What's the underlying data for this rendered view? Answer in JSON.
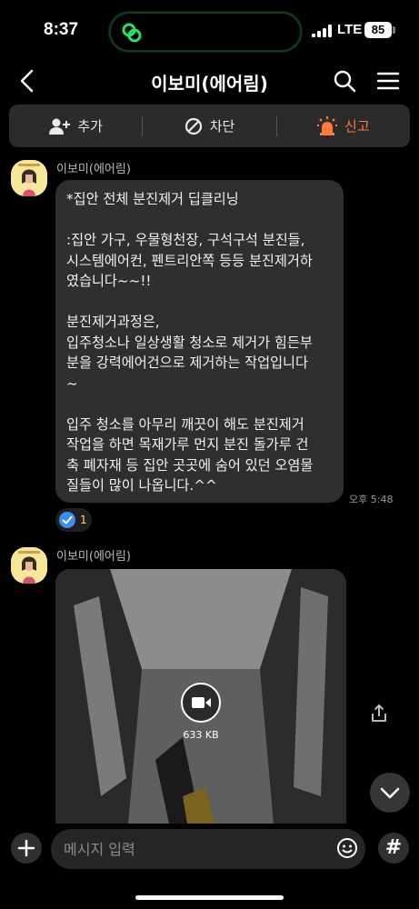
{
  "status_bar": {
    "time": "8:37",
    "network": "LTE",
    "battery": "85",
    "island_icon": "link-icon"
  },
  "header": {
    "title": "이보미(에어림)",
    "icons": [
      "back-icon",
      "search-icon",
      "menu-icon"
    ]
  },
  "action_bar": {
    "add_label": "추가",
    "block_label": "차단",
    "report_label": "신고"
  },
  "messages": [
    {
      "sender": "이보미(에어림)",
      "text": "*집안 전체 분진제거 딥클리닝\n\n:집안 가구, 우물형천장, 구석구석 분진들,\n시스템에어컨, 펜트리안쪽 등등 분진제거하\n였습니다~~!!\n\n분진제거과정은,\n입주청소나 일상생활 청소로 제거가 힘든부\n분을 강력에어건으로 제거하는 작업입니다\n~\n\n입주 청소를 아무리 깨끗이 해도 분진제거\n작업을 하면 목재가루 먼지 분진 돌가루 건\n축 폐자재 등 집안 곳곳에 숨어 있던 오염물\n질들이 많이 나옵니다.^^",
      "time": "오후 5:48",
      "reaction_count": "1"
    },
    {
      "sender": "이보미(에어림)",
      "video_size": "633 KB"
    }
  ],
  "input": {
    "placeholder": "메시지 입력"
  },
  "colors": {
    "report": "#ff7a3b",
    "bubble": "#2f2f2f",
    "island_green": "#2ee060"
  }
}
